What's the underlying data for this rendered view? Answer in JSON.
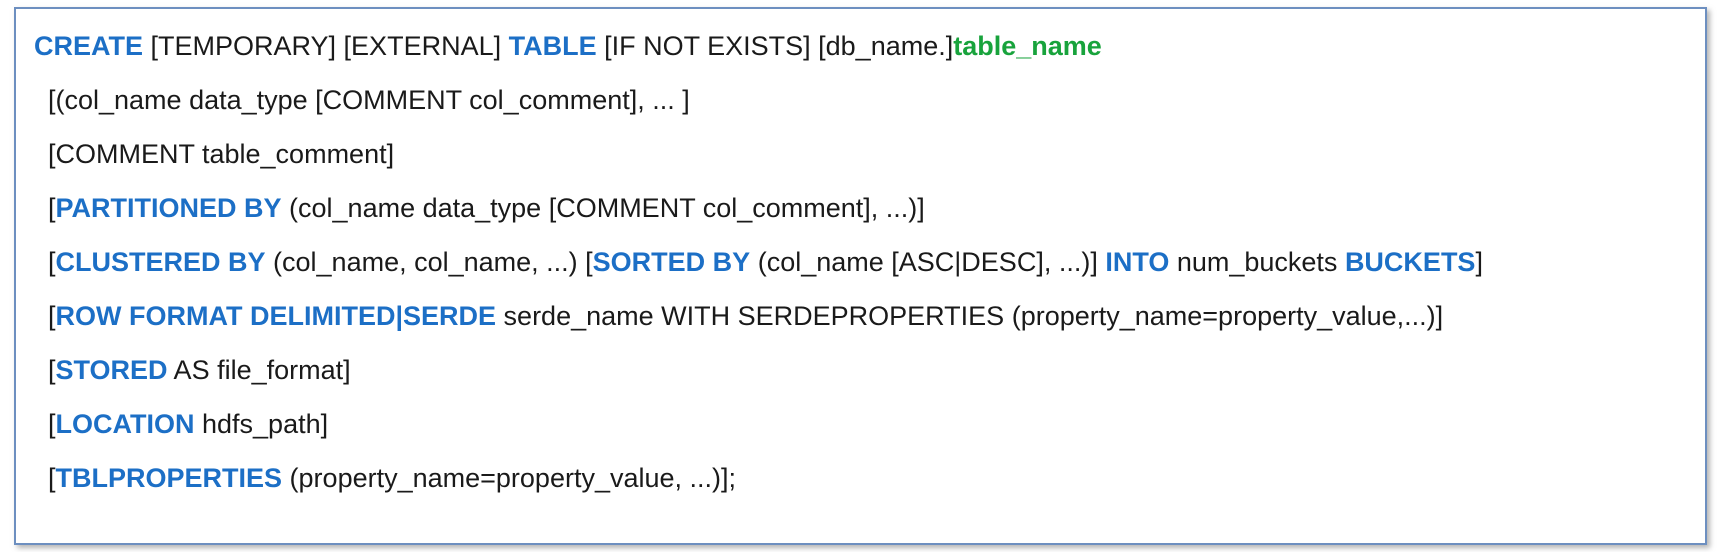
{
  "colors": {
    "keyword": "#1c6fc6",
    "table_name": "#18a33c",
    "text": "#1a1a1a",
    "border": "#6d8fc0"
  },
  "lines": [
    [
      {
        "text": "CREATE",
        "kind": "keyword"
      },
      {
        "text": " [TEMPORARY] [EXTERNAL] ",
        "kind": "text"
      },
      {
        "text": "TABLE",
        "kind": "keyword"
      },
      {
        "text": " [IF NOT EXISTS] [db_name.]",
        "kind": "text"
      },
      {
        "text": "table_name",
        "kind": "table_name"
      }
    ],
    [
      {
        "text": "[(col_name data_type [COMMENT col_comment], ... ]",
        "kind": "text"
      }
    ],
    [
      {
        "text": "[COMMENT table_comment]",
        "kind": "text"
      }
    ],
    [
      {
        "text": "[",
        "kind": "text"
      },
      {
        "text": "PARTITIONED BY",
        "kind": "keyword"
      },
      {
        "text": " (col_name data_type [COMMENT col_comment], ...)]",
        "kind": "text"
      }
    ],
    [
      {
        "text": "[",
        "kind": "text"
      },
      {
        "text": "CLUSTERED BY",
        "kind": "keyword"
      },
      {
        "text": " (col_name, col_name, ...) [",
        "kind": "text"
      },
      {
        "text": "SORTED BY",
        "kind": "keyword"
      },
      {
        "text": " (col_name [ASC|DESC], ...)] ",
        "kind": "text"
      },
      {
        "text": "INTO",
        "kind": "keyword"
      },
      {
        "text": " num_buckets ",
        "kind": "text"
      },
      {
        "text": "BUCKETS",
        "kind": "keyword"
      },
      {
        "text": "]",
        "kind": "text"
      }
    ],
    [
      {
        "text": "[",
        "kind": "text"
      },
      {
        "text": "ROW FORMAT DELIMITED|SERDE",
        "kind": "keyword"
      },
      {
        "text": " serde_name WITH SERDEPROPERTIES (property_name=property_value,...)]",
        "kind": "text"
      }
    ],
    [
      {
        "text": "[",
        "kind": "text"
      },
      {
        "text": "STORED",
        "kind": "keyword"
      },
      {
        "text": " AS file_format]",
        "kind": "text"
      }
    ],
    [
      {
        "text": "[",
        "kind": "text"
      },
      {
        "text": "LOCATION",
        "kind": "keyword"
      },
      {
        "text": " hdfs_path]",
        "kind": "text"
      }
    ],
    [
      {
        "text": "[",
        "kind": "text"
      },
      {
        "text": "TBLPROPERTIES",
        "kind": "keyword"
      },
      {
        "text": " (property_name=property_value, ...)];",
        "kind": "text"
      }
    ]
  ]
}
